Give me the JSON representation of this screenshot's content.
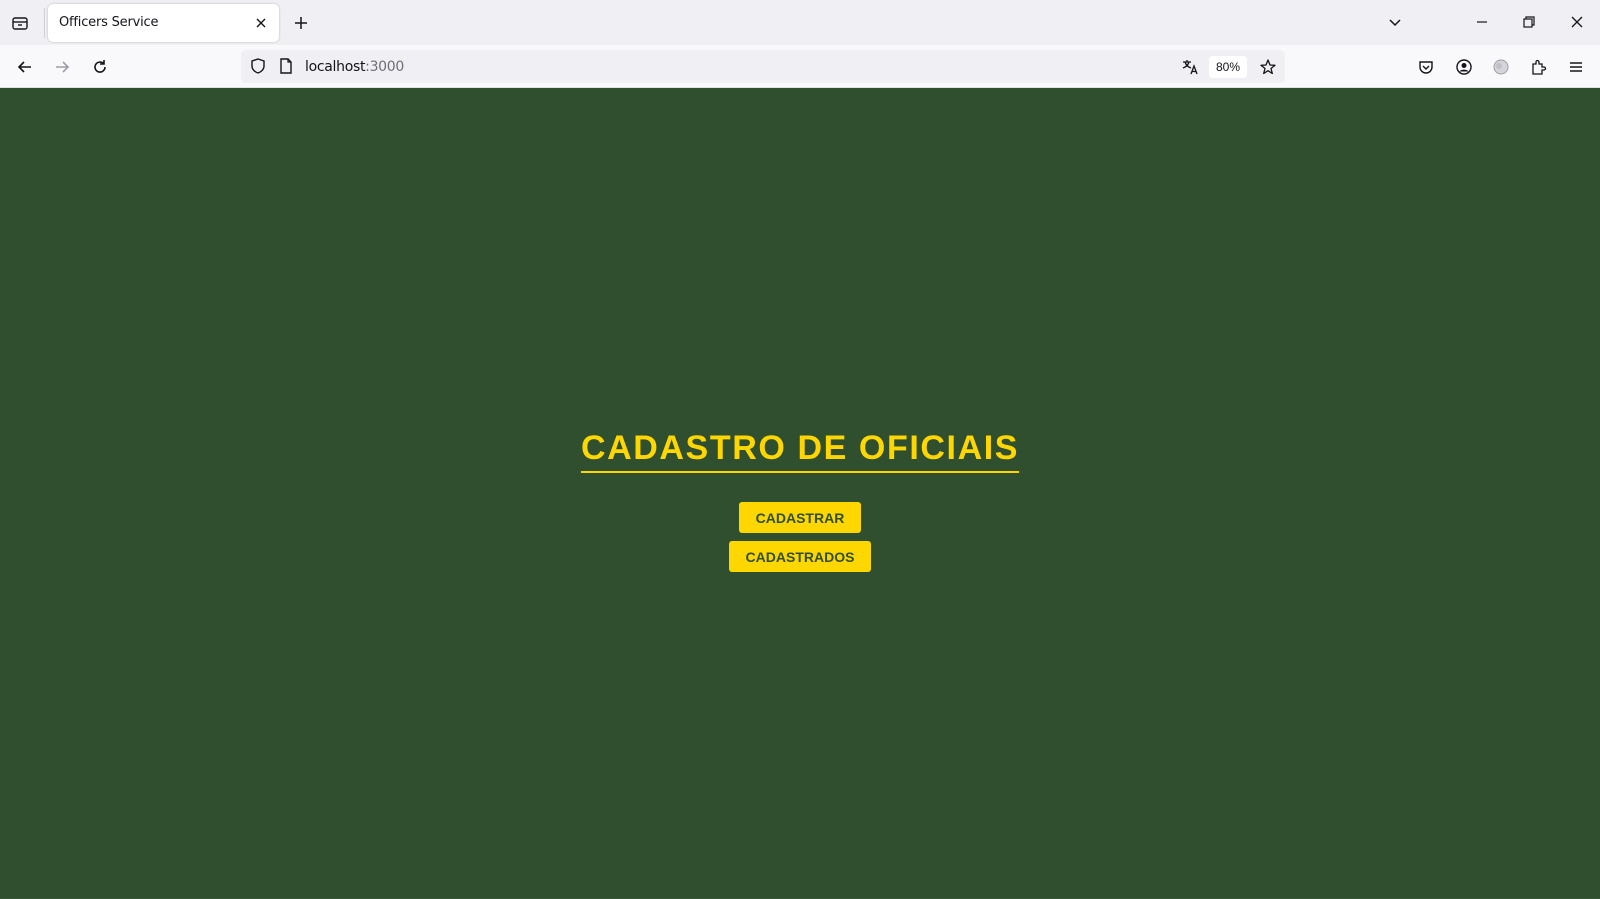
{
  "browser": {
    "tab": {
      "title": "Officers Service"
    },
    "url": {
      "host": "localhost",
      "port": ":3000"
    },
    "zoom": "80%"
  },
  "page": {
    "heading": "CADASTRO DE OFICIAIS",
    "buttons": {
      "register": "CADASTRAR",
      "registered": "CADASTRADOS"
    }
  },
  "colors": {
    "background": "#2f4f2f",
    "accent": "#ffd700"
  },
  "icons": {
    "tab_list": "tab-list-icon",
    "close_tab": "close-icon",
    "new_tab": "plus-icon",
    "back": "arrow-left-icon",
    "forward": "arrow-right-icon",
    "reload": "reload-icon",
    "tracking": "shield-icon",
    "page_info": "page-icon",
    "translate": "translate-icon",
    "bookmark": "star-icon",
    "pocket": "pocket-icon",
    "account": "account-icon",
    "extension": "extension-icon",
    "extensions": "puzzle-icon",
    "menu": "hamburger-icon"
  }
}
